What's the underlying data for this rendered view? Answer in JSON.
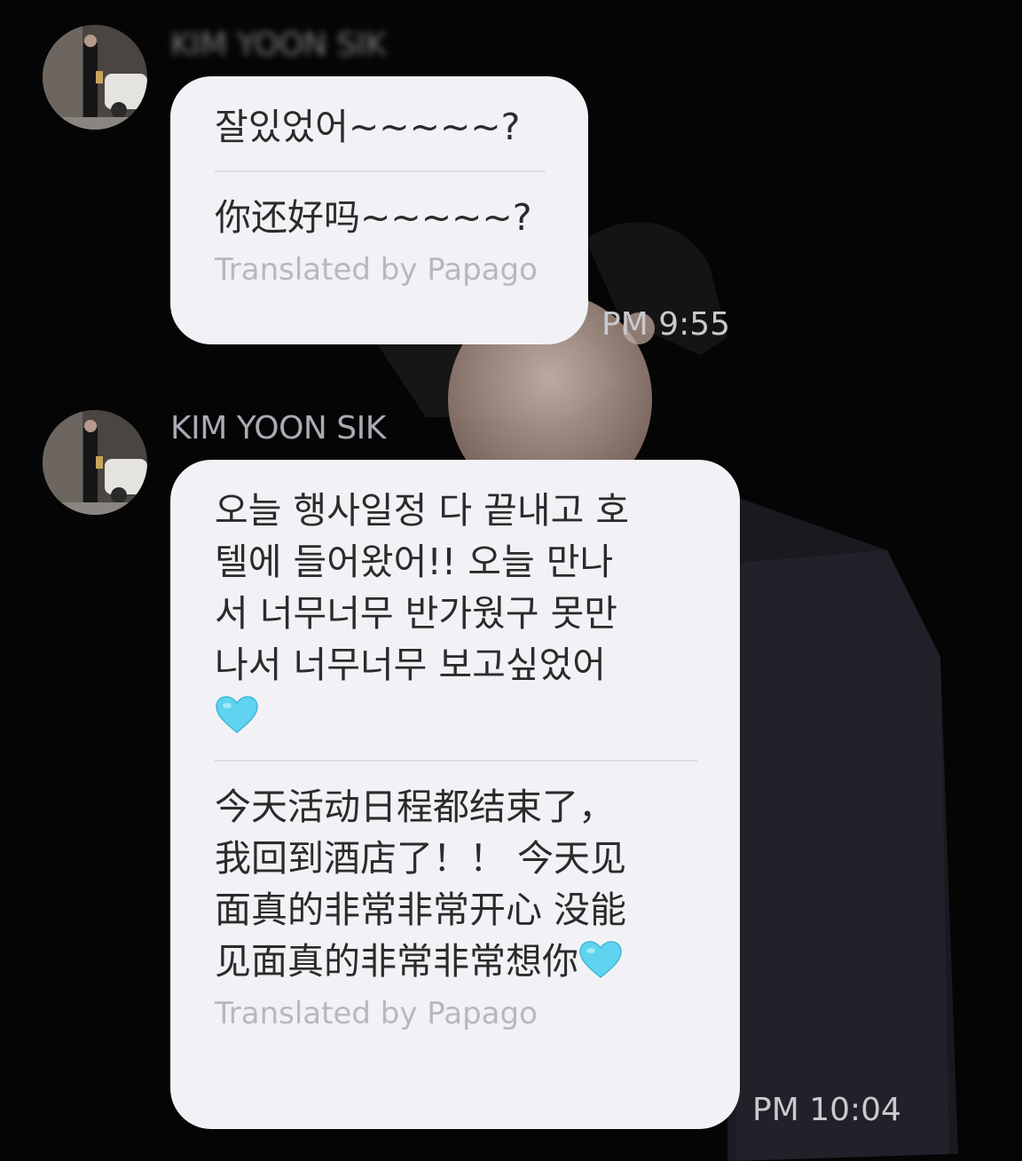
{
  "messages": [
    {
      "sender": "KIM YOON SIK",
      "original": "잘있었어~~~~~?",
      "translation": "你还好吗~~~~~?",
      "credit": "Translated by Papago",
      "time": "PM 9:55"
    },
    {
      "sender": "KIM YOON SIK",
      "original_lines": [
        "오늘 행사일정 다 끝내고 호",
        "텔에 들어왔어!! 오늘 만나",
        "서 너무너무 반가웠구 못만",
        "나서 너무너무 보고싶었어"
      ],
      "original_emoji": "heart-icon",
      "translation_lines": [
        "今天活动日程都结束了，",
        "我回到酒店了！！ 今天见",
        "面真的非常非常开心 没能",
        "见面真的非常非常想你"
      ],
      "translation_emoji": "heart-icon",
      "credit": "Translated by Papago",
      "time": "PM 10:04"
    }
  ],
  "colors": {
    "background": "#050505",
    "bubble": "#f2f2f6",
    "heart": "#5fd3ef"
  }
}
